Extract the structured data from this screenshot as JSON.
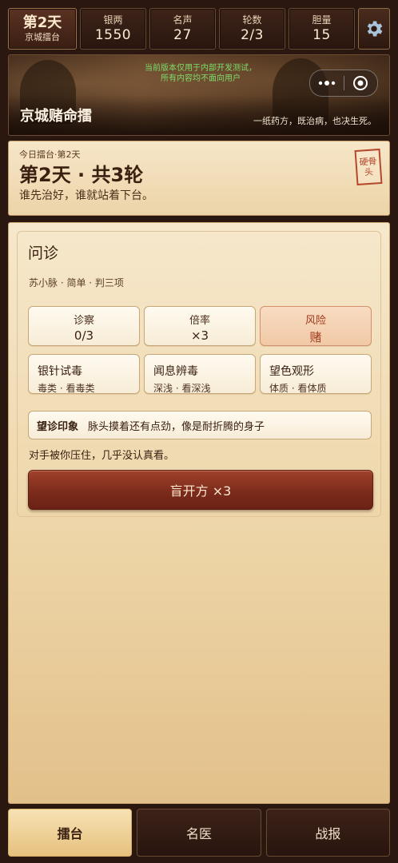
{
  "stats": {
    "day_label": "第2天",
    "day_location": "京城擂台",
    "items": [
      {
        "label": "银两",
        "value": "1550"
      },
      {
        "label": "名声",
        "value": "27"
      },
      {
        "label": "轮数",
        "value": "2/3"
      },
      {
        "label": "胆量",
        "value": "15"
      }
    ]
  },
  "banner": {
    "notice_line1": "当前版本仅用于内部开发测试，",
    "notice_line2": "所有内容均不面向用户",
    "title": "京城赌命擂",
    "tagline": "一纸药方，既治病，也决生死。"
  },
  "day_card": {
    "small": "今日擂台·第2天",
    "heading": "第2天 · 共3轮",
    "subtitle": "谁先治好，谁就站着下台。",
    "stamp": "硬骨头"
  },
  "consult": {
    "heading": "问诊",
    "meta": "苏小脉 · 简单 · 判三项",
    "metrics": [
      {
        "label": "诊察",
        "value": "0/3"
      },
      {
        "label": "倍率",
        "value": "×3"
      },
      {
        "label": "风险",
        "value": "赌"
      }
    ],
    "actions": [
      {
        "title": "银针试毒",
        "sub": "毒类 · 看毒类"
      },
      {
        "title": "闻息辨毒",
        "sub": "深浅 · 看深浅"
      },
      {
        "title": "望色观形",
        "sub": "体质 · 看体质"
      }
    ],
    "impression_key": "望诊印象",
    "impression_text": "脉头摸着还有点劲，像是耐折腾的身子",
    "opponent": "对手被你压住，几乎没认真看。",
    "blind_button": "盲开方  ×3"
  },
  "nav": {
    "tabs": [
      "擂台",
      "名医",
      "战报"
    ]
  },
  "colors": {
    "accent_red": "#7a2a1a",
    "risk_red": "#a23a1c",
    "notice_green": "#7ddc6a"
  }
}
